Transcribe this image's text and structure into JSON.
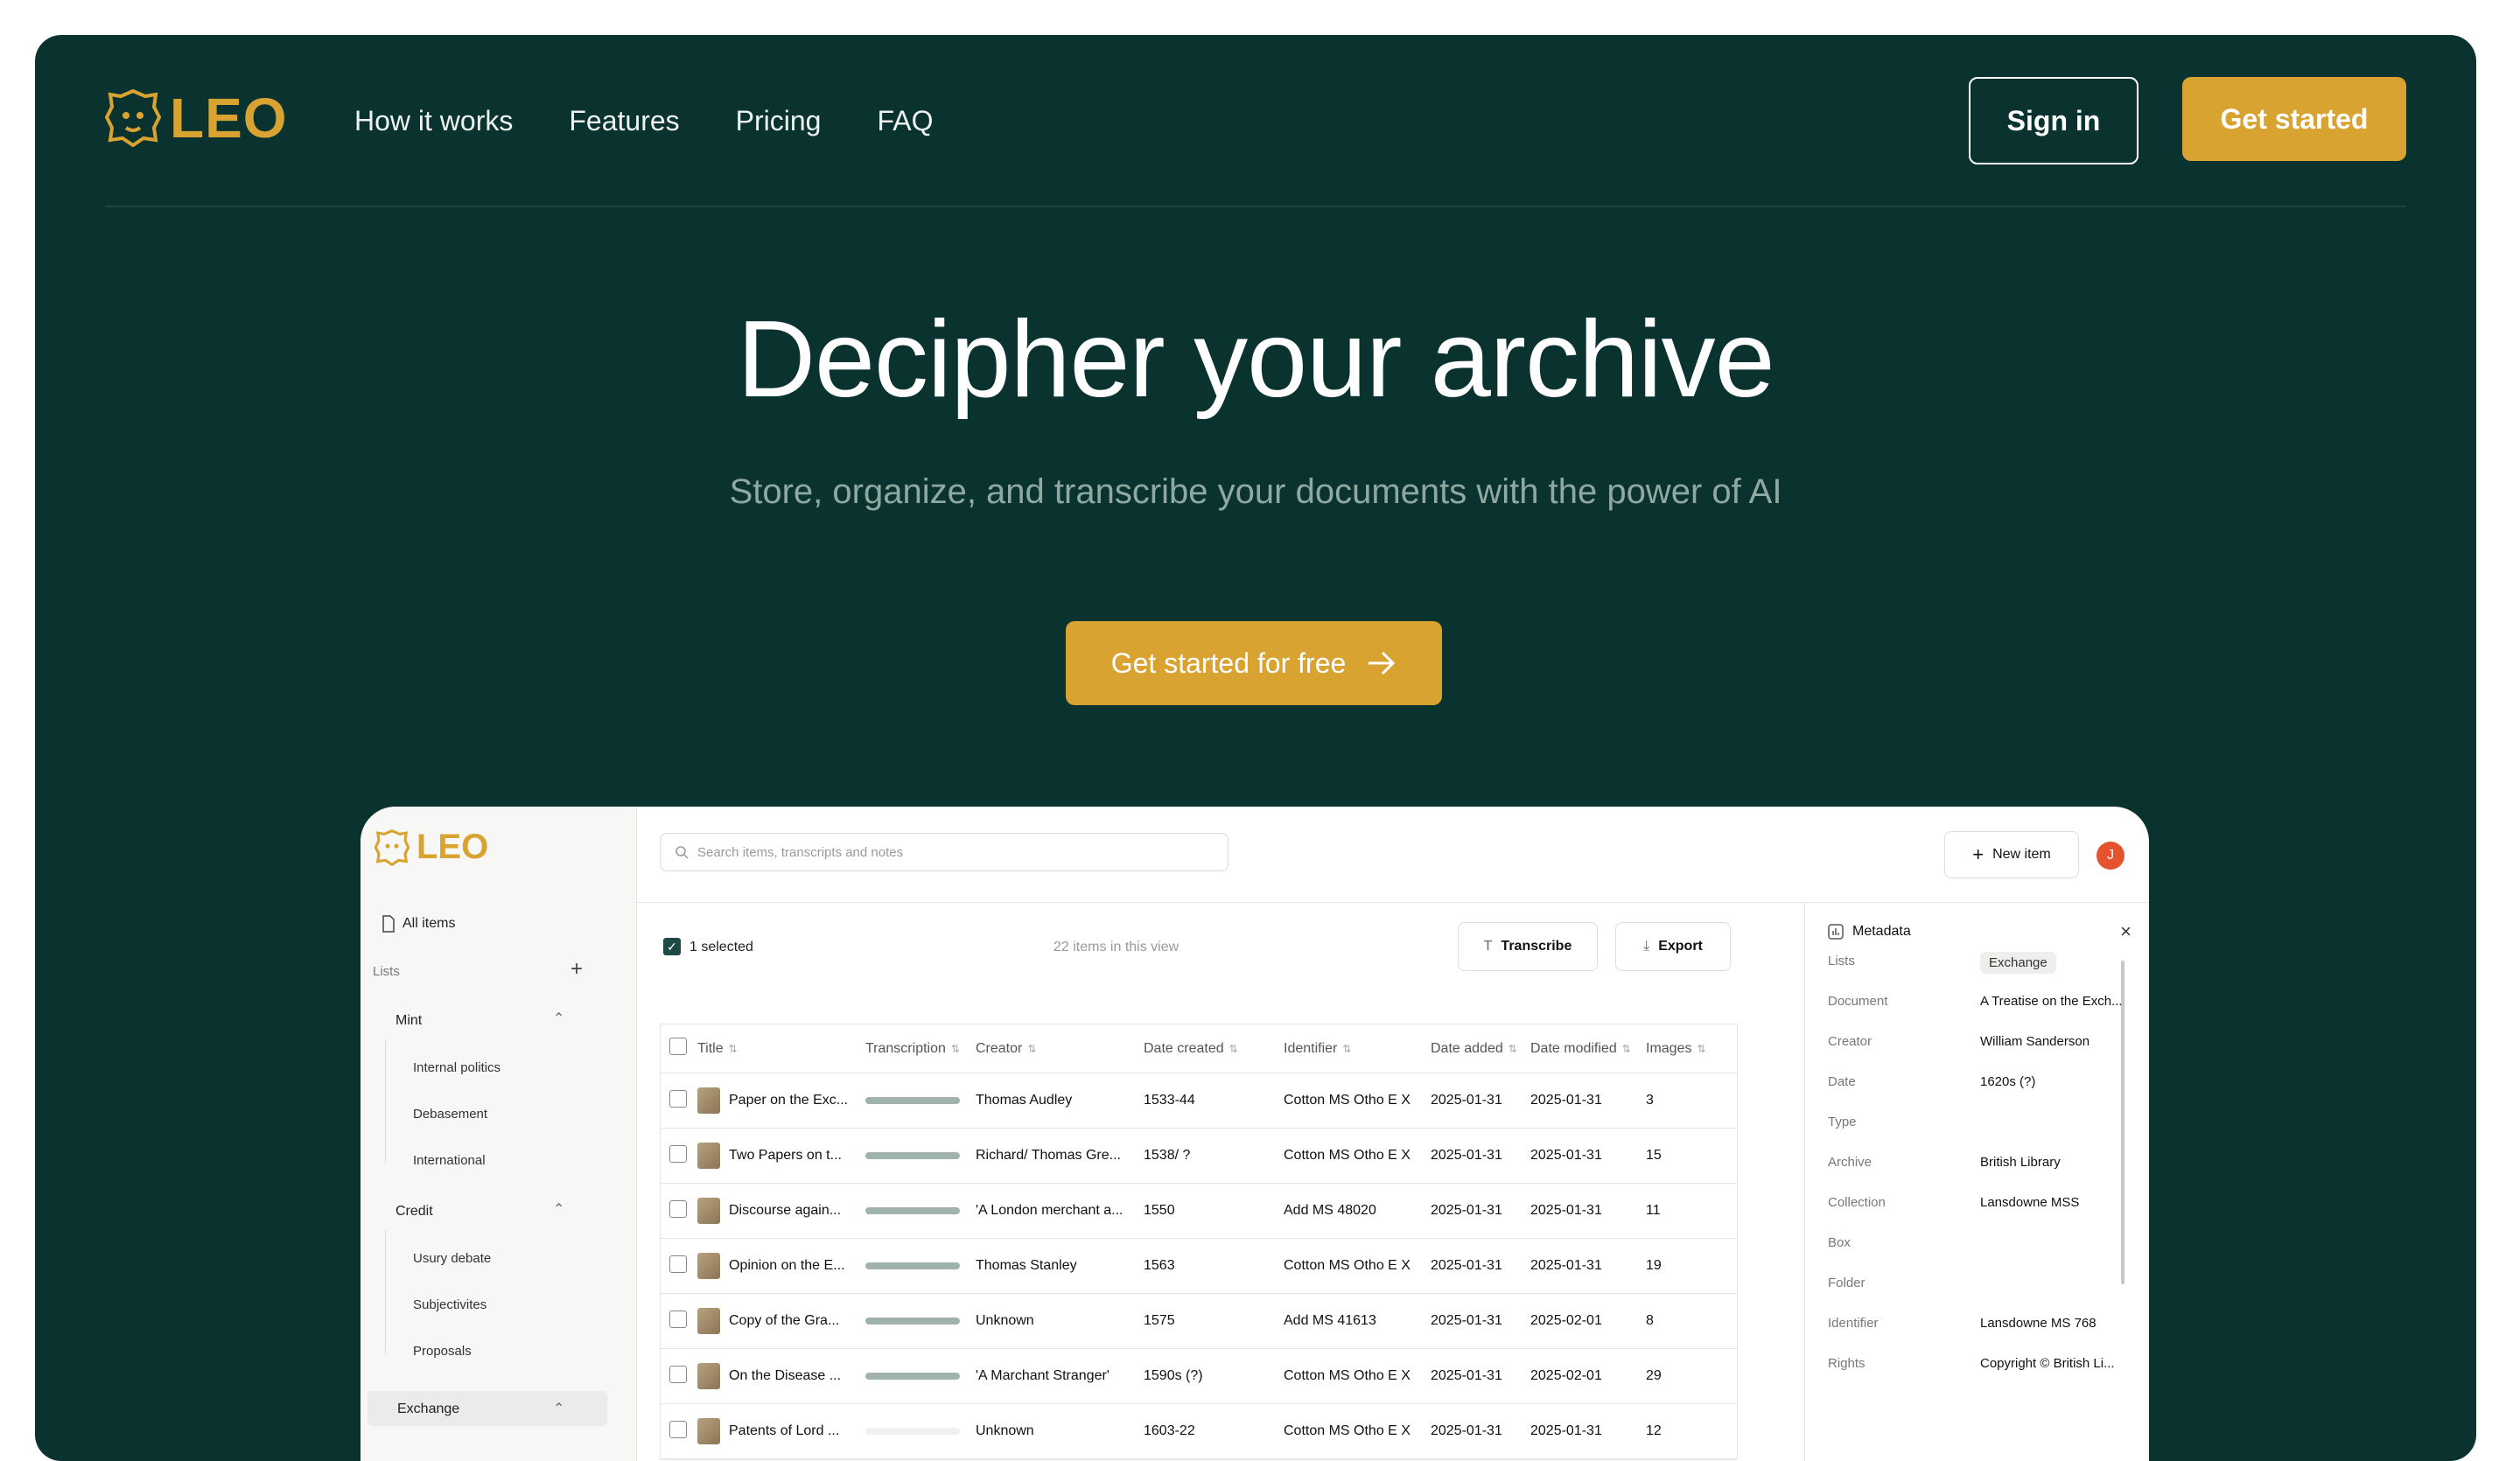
{
  "brand": {
    "name": "LEO",
    "accent": "#d9a331",
    "bg": "#0a3330"
  },
  "nav": {
    "links": [
      "How it works",
      "Features",
      "Pricing",
      "FAQ"
    ],
    "signin": "Sign in",
    "get_started": "Get started"
  },
  "hero": {
    "title": "Decipher your archive",
    "subtitle": "Store, organize, and transcribe your documents with the power of AI",
    "cta": "Get started for free"
  },
  "app": {
    "logo": "LEO",
    "sidebar": {
      "all_items": "All items",
      "lists_label": "Lists",
      "groups": [
        {
          "name": "Mint",
          "items": [
            "Internal politics",
            "Debasement",
            "International"
          ]
        },
        {
          "name": "Credit",
          "items": [
            "Usury debate",
            "Subjectivites",
            "Proposals"
          ]
        },
        {
          "name": "Exchange",
          "items": []
        }
      ]
    },
    "search_placeholder": "Search items, transcripts and notes",
    "new_item": "New item",
    "avatar": "J",
    "toolbar": {
      "selected": "1 selected",
      "count": "22 items in this view",
      "transcribe": "Transcribe",
      "export": "Export"
    },
    "table": {
      "headers": [
        "Title",
        "Transcription",
        "Creator",
        "Date created",
        "Identifier",
        "Date added",
        "Date modified",
        "Images"
      ],
      "rows": [
        {
          "title": "Paper on the Exc...",
          "transcribed": true,
          "creator": "Thomas Audley",
          "created": "1533-44",
          "identifier": "Cotton MS Otho E X",
          "added": "2025-01-31",
          "modified": "2025-01-31",
          "images": "3"
        },
        {
          "title": "Two Papers on t...",
          "transcribed": true,
          "creator": "Richard/ Thomas Gre...",
          "created": "1538/ ?",
          "identifier": "Cotton MS Otho E X",
          "added": "2025-01-31",
          "modified": "2025-01-31",
          "images": "15"
        },
        {
          "title": "Discourse again...",
          "transcribed": true,
          "creator": "'A London merchant a...",
          "created": "1550",
          "identifier": "Add MS 48020",
          "added": "2025-01-31",
          "modified": "2025-01-31",
          "images": "11"
        },
        {
          "title": "Opinion on the E...",
          "transcribed": true,
          "creator": "Thomas Stanley",
          "created": "1563",
          "identifier": "Cotton MS Otho E X",
          "added": "2025-01-31",
          "modified": "2025-01-31",
          "images": "19"
        },
        {
          "title": "Copy of the Gra...",
          "transcribed": true,
          "creator": "Unknown",
          "created": "1575",
          "identifier": "Add MS 41613",
          "added": "2025-01-31",
          "modified": "2025-02-01",
          "images": "8"
        },
        {
          "title": "On the Disease ...",
          "transcribed": true,
          "creator": "'A Marchant Stranger'",
          "created": "1590s (?)",
          "identifier": "Cotton MS Otho E X",
          "added": "2025-01-31",
          "modified": "2025-02-01",
          "images": "29"
        },
        {
          "title": "Patents of Lord ...",
          "transcribed": false,
          "creator": "Unknown",
          "created": "1603-22",
          "identifier": "Cotton MS Otho E X",
          "added": "2025-01-31",
          "modified": "2025-01-31",
          "images": "12"
        }
      ]
    },
    "metadata": {
      "title": "Metadata",
      "fields": [
        {
          "label": "Lists",
          "value": "Exchange",
          "chip": true
        },
        {
          "label": "Document",
          "value": "A Treatise on the Exch..."
        },
        {
          "label": "Creator",
          "value": "William Sanderson"
        },
        {
          "label": "Date",
          "value": "1620s (?)"
        },
        {
          "label": "Type",
          "value": ""
        },
        {
          "label": "Archive",
          "value": "British Library"
        },
        {
          "label": "Collection",
          "value": "Lansdowne MSS"
        },
        {
          "label": "Box",
          "value": ""
        },
        {
          "label": "Folder",
          "value": ""
        },
        {
          "label": "Identifier",
          "value": "Lansdowne MS 768"
        },
        {
          "label": "Rights",
          "value": "Copyright © British Li..."
        }
      ]
    }
  }
}
